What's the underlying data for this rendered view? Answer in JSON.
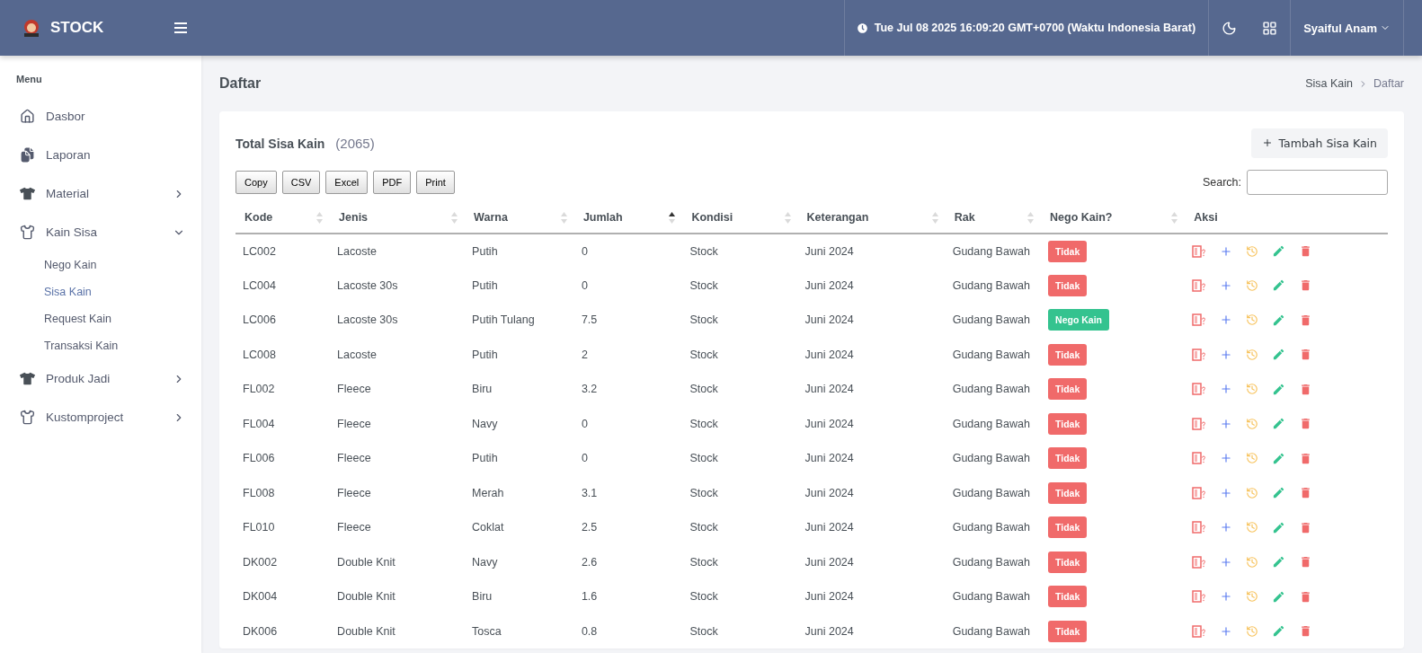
{
  "brand": {
    "name": "STOCK"
  },
  "topbar": {
    "datetime": "Tue Jul 08 2025 16:09:20 GMT+0700 (Waktu Indonesia Barat)",
    "user": "Syaiful Anam"
  },
  "sidebar": {
    "heading": "Menu",
    "items": [
      {
        "label": "Dasbor",
        "expandable": false,
        "expanded": false
      },
      {
        "label": "Laporan",
        "expandable": false,
        "expanded": false
      },
      {
        "label": "Material",
        "expandable": true,
        "expanded": false
      },
      {
        "label": "Kain Sisa",
        "expandable": true,
        "expanded": true,
        "children": [
          {
            "label": "Nego Kain",
            "selected": false
          },
          {
            "label": "Sisa Kain",
            "selected": true
          },
          {
            "label": "Request Kain",
            "selected": false
          },
          {
            "label": "Transaksi Kain",
            "selected": false
          }
        ]
      },
      {
        "label": "Produk Jadi",
        "expandable": true,
        "expanded": false
      },
      {
        "label": "Kustomproject",
        "expandable": true,
        "expanded": false
      }
    ]
  },
  "page": {
    "title": "Daftar",
    "breadcrumb": [
      "Sisa Kain",
      "Daftar"
    ]
  },
  "card": {
    "title": "Total Sisa Kain",
    "count": "(2065)",
    "add_button": "Tambah Sisa Kain",
    "export_buttons": [
      "Copy",
      "CSV",
      "Excel",
      "PDF",
      "Print"
    ],
    "search_label": "Search:"
  },
  "table": {
    "columns": [
      {
        "label": "Kode",
        "sortable": true,
        "sorted": false
      },
      {
        "label": "Jenis",
        "sortable": true,
        "sorted": false
      },
      {
        "label": "Warna",
        "sortable": true,
        "sorted": false
      },
      {
        "label": "Jumlah",
        "sortable": true,
        "sorted": true
      },
      {
        "label": "Kondisi",
        "sortable": true,
        "sorted": false
      },
      {
        "label": "Keterangan",
        "sortable": true,
        "sorted": false
      },
      {
        "label": "Rak",
        "sortable": true,
        "sorted": false
      },
      {
        "label": "Nego Kain?",
        "sortable": true,
        "sorted": false
      },
      {
        "label": "Aksi",
        "sortable": false,
        "sorted": false
      }
    ],
    "rows": [
      {
        "cells": [
          "LC002",
          "Lacoste",
          "Putih",
          "0",
          "Stock",
          "Juni 2024",
          "Gudang Bawah"
        ],
        "nego": false,
        "badge": "Tidak"
      },
      {
        "cells": [
          "LC004",
          "Lacoste 30s",
          "Putih",
          "0",
          "Stock",
          "Juni 2024",
          "Gudang Bawah"
        ],
        "nego": false,
        "badge": "Tidak"
      },
      {
        "cells": [
          "LC006",
          "Lacoste 30s",
          "Putih Tulang",
          "7.5",
          "Stock",
          "Juni 2024",
          "Gudang Bawah"
        ],
        "nego": true,
        "badge": "Nego Kain"
      },
      {
        "cells": [
          "LC008",
          "Lacoste",
          "Putih",
          "2",
          "Stock",
          "Juni 2024",
          "Gudang Bawah"
        ],
        "nego": false,
        "badge": "Tidak"
      },
      {
        "cells": [
          "FL002",
          "Fleece",
          "Biru",
          "3.2",
          "Stock",
          "Juni 2024",
          "Gudang Bawah"
        ],
        "nego": false,
        "badge": "Tidak"
      },
      {
        "cells": [
          "FL004",
          "Fleece",
          "Navy",
          "0",
          "Stock",
          "Juni 2024",
          "Gudang Bawah"
        ],
        "nego": false,
        "badge": "Tidak"
      },
      {
        "cells": [
          "FL006",
          "Fleece",
          "Putih",
          "0",
          "Stock",
          "Juni 2024",
          "Gudang Bawah"
        ],
        "nego": false,
        "badge": "Tidak"
      },
      {
        "cells": [
          "FL008",
          "Fleece",
          "Merah",
          "3.1",
          "Stock",
          "Juni 2024",
          "Gudang Bawah"
        ],
        "nego": false,
        "badge": "Tidak"
      },
      {
        "cells": [
          "FL010",
          "Fleece",
          "Coklat",
          "2.5",
          "Stock",
          "Juni 2024",
          "Gudang Bawah"
        ],
        "nego": false,
        "badge": "Tidak"
      },
      {
        "cells": [
          "DK002",
          "Double Knit",
          "Navy",
          "2.6",
          "Stock",
          "Juni 2024",
          "Gudang Bawah"
        ],
        "nego": false,
        "badge": "Tidak"
      },
      {
        "cells": [
          "DK004",
          "Double Knit",
          "Biru",
          "1.6",
          "Stock",
          "Juni 2024",
          "Gudang Bawah"
        ],
        "nego": false,
        "badge": "Tidak"
      },
      {
        "cells": [
          "DK006",
          "Double Knit",
          "Tosca",
          "0.8",
          "Stock",
          "Juni 2024",
          "Gudang Bawah"
        ],
        "nego": false,
        "badge": "Tidak"
      }
    ]
  }
}
